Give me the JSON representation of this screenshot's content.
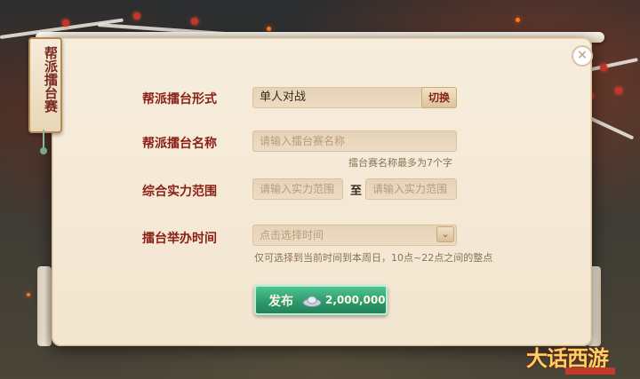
{
  "panel": {
    "tab_title": "帮派擂台赛",
    "close_symbol": "×"
  },
  "form": {
    "mode": {
      "label": "帮派擂台形式",
      "value": "单人对战",
      "switch_label": "切换"
    },
    "name": {
      "label": "帮派擂台名称",
      "placeholder": "请输入擂台赛名称",
      "hint": "擂台赛名称最多为7个字"
    },
    "power": {
      "label": "综合实力范围",
      "min_placeholder": "请输入实力范围",
      "separator": "至",
      "max_placeholder": "请输入实力范围"
    },
    "time": {
      "label": "擂台举办时间",
      "placeholder": "点击选择时间",
      "hint": "仅可选择到当前时间到本周日，10点~22点之间的整点"
    }
  },
  "publish": {
    "label": "发布",
    "cost": "2,000,000",
    "currency_icon": "silver-ingot-icon"
  },
  "logo": {
    "text": "大话西游"
  },
  "colors": {
    "label_red": "#8a1f14",
    "publish_green": "#2d9b6d",
    "parchment": "#f3e6d0"
  }
}
